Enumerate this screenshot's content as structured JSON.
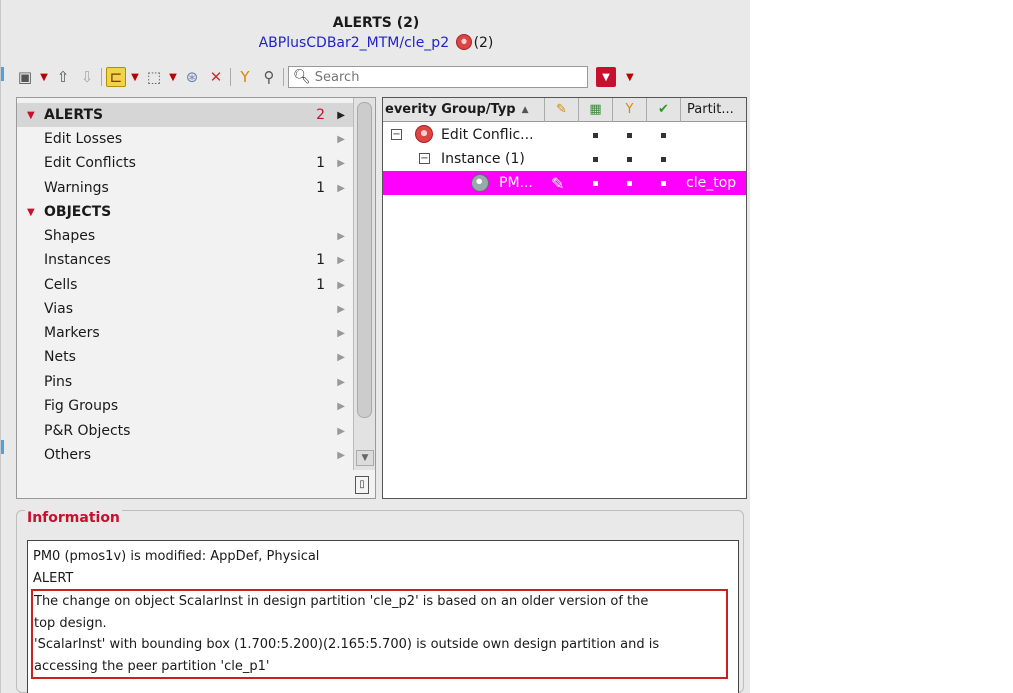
{
  "header": {
    "title": "ALERTS (2)",
    "subtitle": "ABPlusCDBar2_MTM/cle_p2",
    "subtitle_count": "(2)"
  },
  "toolbar": {
    "search_placeholder": "Search"
  },
  "categories": {
    "alerts": {
      "label": "ALERTS",
      "count": "2"
    },
    "objects": {
      "label": "OBJECTS"
    }
  },
  "alert_items": [
    {
      "label": "Edit Losses",
      "count": ""
    },
    {
      "label": "Edit Conflicts",
      "count": "1"
    },
    {
      "label": "Warnings",
      "count": "1"
    }
  ],
  "object_items": [
    {
      "label": "Shapes",
      "count": ""
    },
    {
      "label": "Instances",
      "count": "1"
    },
    {
      "label": "Cells",
      "count": "1"
    },
    {
      "label": "Vias",
      "count": ""
    },
    {
      "label": "Markers",
      "count": ""
    },
    {
      "label": "Nets",
      "count": ""
    },
    {
      "label": "Pins",
      "count": ""
    },
    {
      "label": "Fig Groups",
      "count": ""
    },
    {
      "label": "P&R Objects",
      "count": ""
    },
    {
      "label": "Others",
      "count": ""
    }
  ],
  "grid": {
    "col_severity": "everity Group/Typ",
    "col_partition": "Partit...",
    "rows": [
      {
        "label": "Edit Conflic...",
        "partition": ""
      },
      {
        "label": "Instance (1)",
        "partition": ""
      },
      {
        "label": "PM...",
        "partition": "cle_top"
      }
    ]
  },
  "info": {
    "title": "Information",
    "line1": "PM0 (pmos1v) is modified: AppDef, Physical",
    "line2": "ALERT",
    "line3": "The change on object ScalarInst in design partition 'cle_p2' is based on an older version of the",
    "line4": "top design.",
    "line5": "'ScalarInst' with bounding box (1.700:5.200)(2.165:5.700) is outside own design partition and is",
    "line6": "accessing the peer partition 'cle_p1'"
  },
  "colors": {
    "highlight_row": "#ff00ff",
    "alert_red": "#c8102e",
    "link_blue": "#2222cc"
  }
}
